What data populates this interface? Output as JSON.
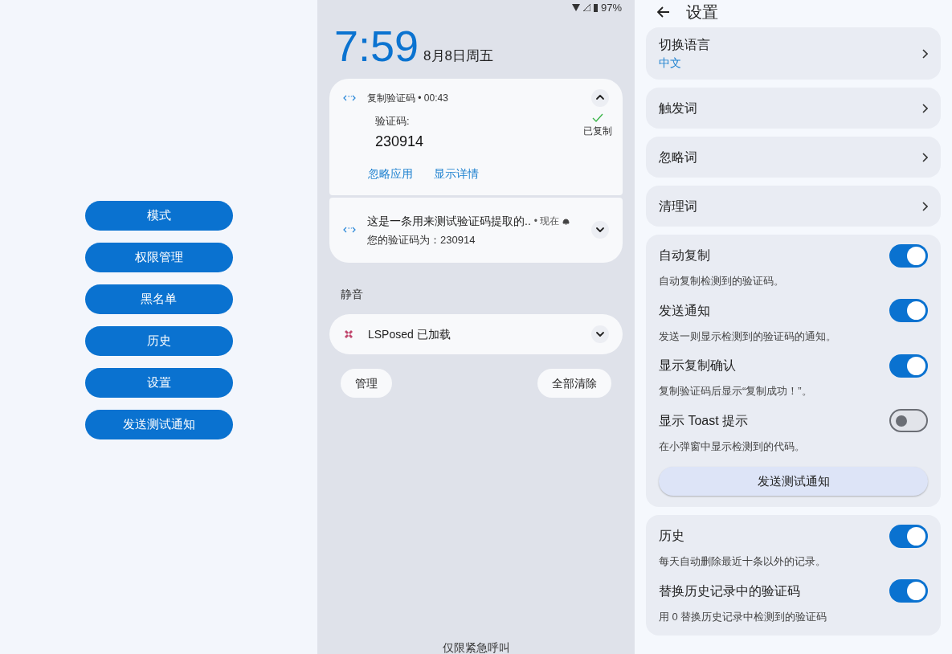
{
  "left_menu": {
    "buttons": [
      "模式",
      "权限管理",
      "黑名单",
      "历史",
      "设置",
      "发送测试通知"
    ]
  },
  "lockscreen": {
    "status_bar": {
      "battery": "97%"
    },
    "time": "7:59",
    "date": "8月8日周五",
    "notifications": [
      {
        "kind": "expanded",
        "header": "复制验证码 • 00:43",
        "expanded": true,
        "code_label": "验证码:",
        "code": "230914",
        "status": "已复制",
        "actions": [
          "忽略应用",
          "显示详情"
        ]
      },
      {
        "kind": "collapsed",
        "title": "这是一条用来测试验证码提取的..",
        "meta": "• 现在",
        "body": "您的验证码为：230914",
        "expanded": false
      }
    ],
    "silent": {
      "title": "静音",
      "notifications": [
        {
          "title": "LSPosed 已加载",
          "expanded": false
        }
      ]
    },
    "buttons": [
      "管理",
      "全部清除"
    ],
    "footer": "仅限紧急呼叫"
  },
  "settings": {
    "title": "设置",
    "nav_items": [
      {
        "label": "切换语言",
        "value": "中文"
      },
      {
        "label": "触发词"
      },
      {
        "label": "忽略词"
      },
      {
        "label": "清理词"
      }
    ],
    "groups": [
      {
        "items": [
          {
            "label": "自动复制",
            "description": "自动复制检测到的验证码。",
            "on": true
          },
          {
            "label": "发送通知",
            "description": "发送一则显示检测到的验证码的通知。",
            "on": true
          },
          {
            "label": "显示复制确认",
            "description": "复制验证码后显示“复制成功！”。",
            "on": true
          },
          {
            "label": "显示 Toast 提示",
            "description": "在小弹窗中显示检测到的代码。",
            "on": false
          }
        ],
        "button": "发送测试通知"
      },
      {
        "items": [
          {
            "label": "历史",
            "description": "每天自动删除最近十条以外的记录。",
            "on": true
          },
          {
            "label": "替换历史记录中的验证码",
            "description": "用 0 替换历史记录中检测到的验证码",
            "on": true
          }
        ]
      }
    ]
  }
}
